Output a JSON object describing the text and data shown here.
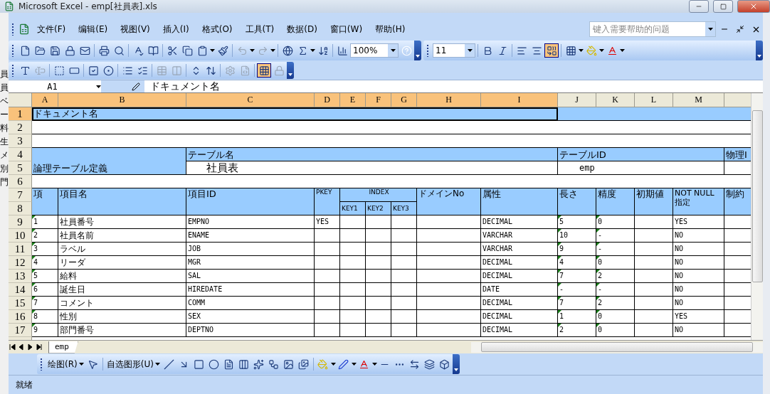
{
  "window": {
    "title": "Microsoft Excel - emp[社員表].xls"
  },
  "menu": [
    {
      "label": "文件(F)"
    },
    {
      "label": "编辑(E)"
    },
    {
      "label": "视图(V)"
    },
    {
      "label": "插入(I)"
    },
    {
      "label": "格式(O)"
    },
    {
      "label": "工具(T)"
    },
    {
      "label": "数据(D)"
    },
    {
      "label": "窗口(W)"
    },
    {
      "label": "帮助(H)"
    }
  ],
  "help_search": {
    "placeholder": "键入需要帮助的问题"
  },
  "standard_toolbar": {
    "zoom": "100%"
  },
  "formatting_toolbar": {
    "font_size": "11",
    "merge_and_center": {
      "pressed": true
    }
  },
  "forms_toolbar": {
    "toggle_grid": {
      "pressed": true
    }
  },
  "name_box": "A1",
  "formula": "ドキュメント名",
  "background_window_edge": [
    "員",
    "員",
    "ベ",
    "ー",
    "料",
    "生",
    "メ",
    "別",
    "門"
  ],
  "columns": [
    {
      "label": "A",
      "selected": true
    },
    {
      "label": "B",
      "selected": true
    },
    {
      "label": "C",
      "selected": true
    },
    {
      "label": "D",
      "selected": true
    },
    {
      "label": "E",
      "selected": true
    },
    {
      "label": "F",
      "selected": true
    },
    {
      "label": "G",
      "selected": true
    },
    {
      "label": "H",
      "selected": true
    },
    {
      "label": "I",
      "selected": true
    },
    {
      "label": "J",
      "selected": false
    },
    {
      "label": "K",
      "selected": false
    },
    {
      "label": "L",
      "selected": false
    },
    {
      "label": "M",
      "selected": false
    }
  ],
  "rows": [
    {
      "label": "1",
      "selected": true
    },
    {
      "label": "2",
      "selected": false
    },
    {
      "label": "3",
      "selected": false
    },
    {
      "label": "4",
      "selected": false
    },
    {
      "label": "5",
      "selected": false
    },
    {
      "label": "6",
      "selected": false
    },
    {
      "label": "7",
      "selected": false
    },
    {
      "label": "8",
      "selected": false
    },
    {
      "label": "9",
      "selected": false
    },
    {
      "label": "10",
      "selected": false
    },
    {
      "label": "11",
      "selected": false
    },
    {
      "label": "12",
      "selected": false
    },
    {
      "label": "13",
      "selected": false
    },
    {
      "label": "14",
      "selected": false
    },
    {
      "label": "15",
      "selected": false
    },
    {
      "label": "16",
      "selected": false
    },
    {
      "label": "17",
      "selected": false
    }
  ],
  "sheet": {
    "document_name": "ドキュメント名",
    "logical_table_label": "論理テーブル定義",
    "table_name_label": "テーブル名",
    "table_name": "社員表",
    "table_id_label": "テーブルID",
    "table_id": "emp",
    "physical_id_label": "物理I",
    "field_headers": {
      "no": "項",
      "name": "項目名",
      "id": "項目ID",
      "pkey": "PKEY",
      "index": "INDEX",
      "key1": "KEY1",
      "key2": "KEY2",
      "key3": "KEY3",
      "domain": "ドメインNo",
      "attribute": "属性",
      "length": "長さ",
      "precision": "精度",
      "default": "初期値",
      "not_null": "NOT NULL 指定",
      "constraint": "制約"
    },
    "fields": [
      {
        "no": "1",
        "name": "社員番号",
        "id": "EMPNO",
        "pkey": "YES",
        "attribute": "DECIMAL",
        "length": "5",
        "precision": "0",
        "not_null": "YES"
      },
      {
        "no": "2",
        "name": "社員名前",
        "id": "ENAME",
        "attribute": "VARCHAR",
        "length": "10",
        "precision": "-",
        "not_null": "NO"
      },
      {
        "no": "3",
        "name": "ラベル",
        "id": "JOB",
        "attribute": "VARCHAR",
        "length": "9",
        "precision": "-",
        "not_null": "NO"
      },
      {
        "no": "4",
        "name": "リーダ",
        "id": "MGR",
        "attribute": "DECIMAL",
        "length": "4",
        "precision": "0",
        "not_null": "NO"
      },
      {
        "no": "5",
        "name": "給料",
        "id": "SAL",
        "attribute": "DECIMAL",
        "length": "7",
        "precision": "2",
        "not_null": "NO"
      },
      {
        "no": "6",
        "name": "誕生日",
        "id": "HIREDATE",
        "attribute": "DATE",
        "length": "-",
        "precision": "-",
        "not_null": "NO"
      },
      {
        "no": "7",
        "name": "コメント",
        "id": "COMM",
        "attribute": "DECIMAL",
        "length": "7",
        "precision": "2",
        "not_null": "NO"
      },
      {
        "no": "8",
        "name": "性別",
        "id": "SEX",
        "attribute": "DECIMAL",
        "length": "1",
        "precision": "0",
        "not_null": "YES"
      },
      {
        "no": "9",
        "name": "部門番号",
        "id": "DEPTNO",
        "attribute": "DECIMAL",
        "length": "2",
        "precision": "0",
        "not_null": "NO"
      }
    ]
  },
  "sheet_tabs": [
    {
      "label": "emp",
      "selected": true
    }
  ],
  "drawing_toolbar": {
    "draw": "绘图(R)",
    "autoshapes": "自选图形(U)"
  },
  "status_bar": {
    "text": "就绪"
  }
}
